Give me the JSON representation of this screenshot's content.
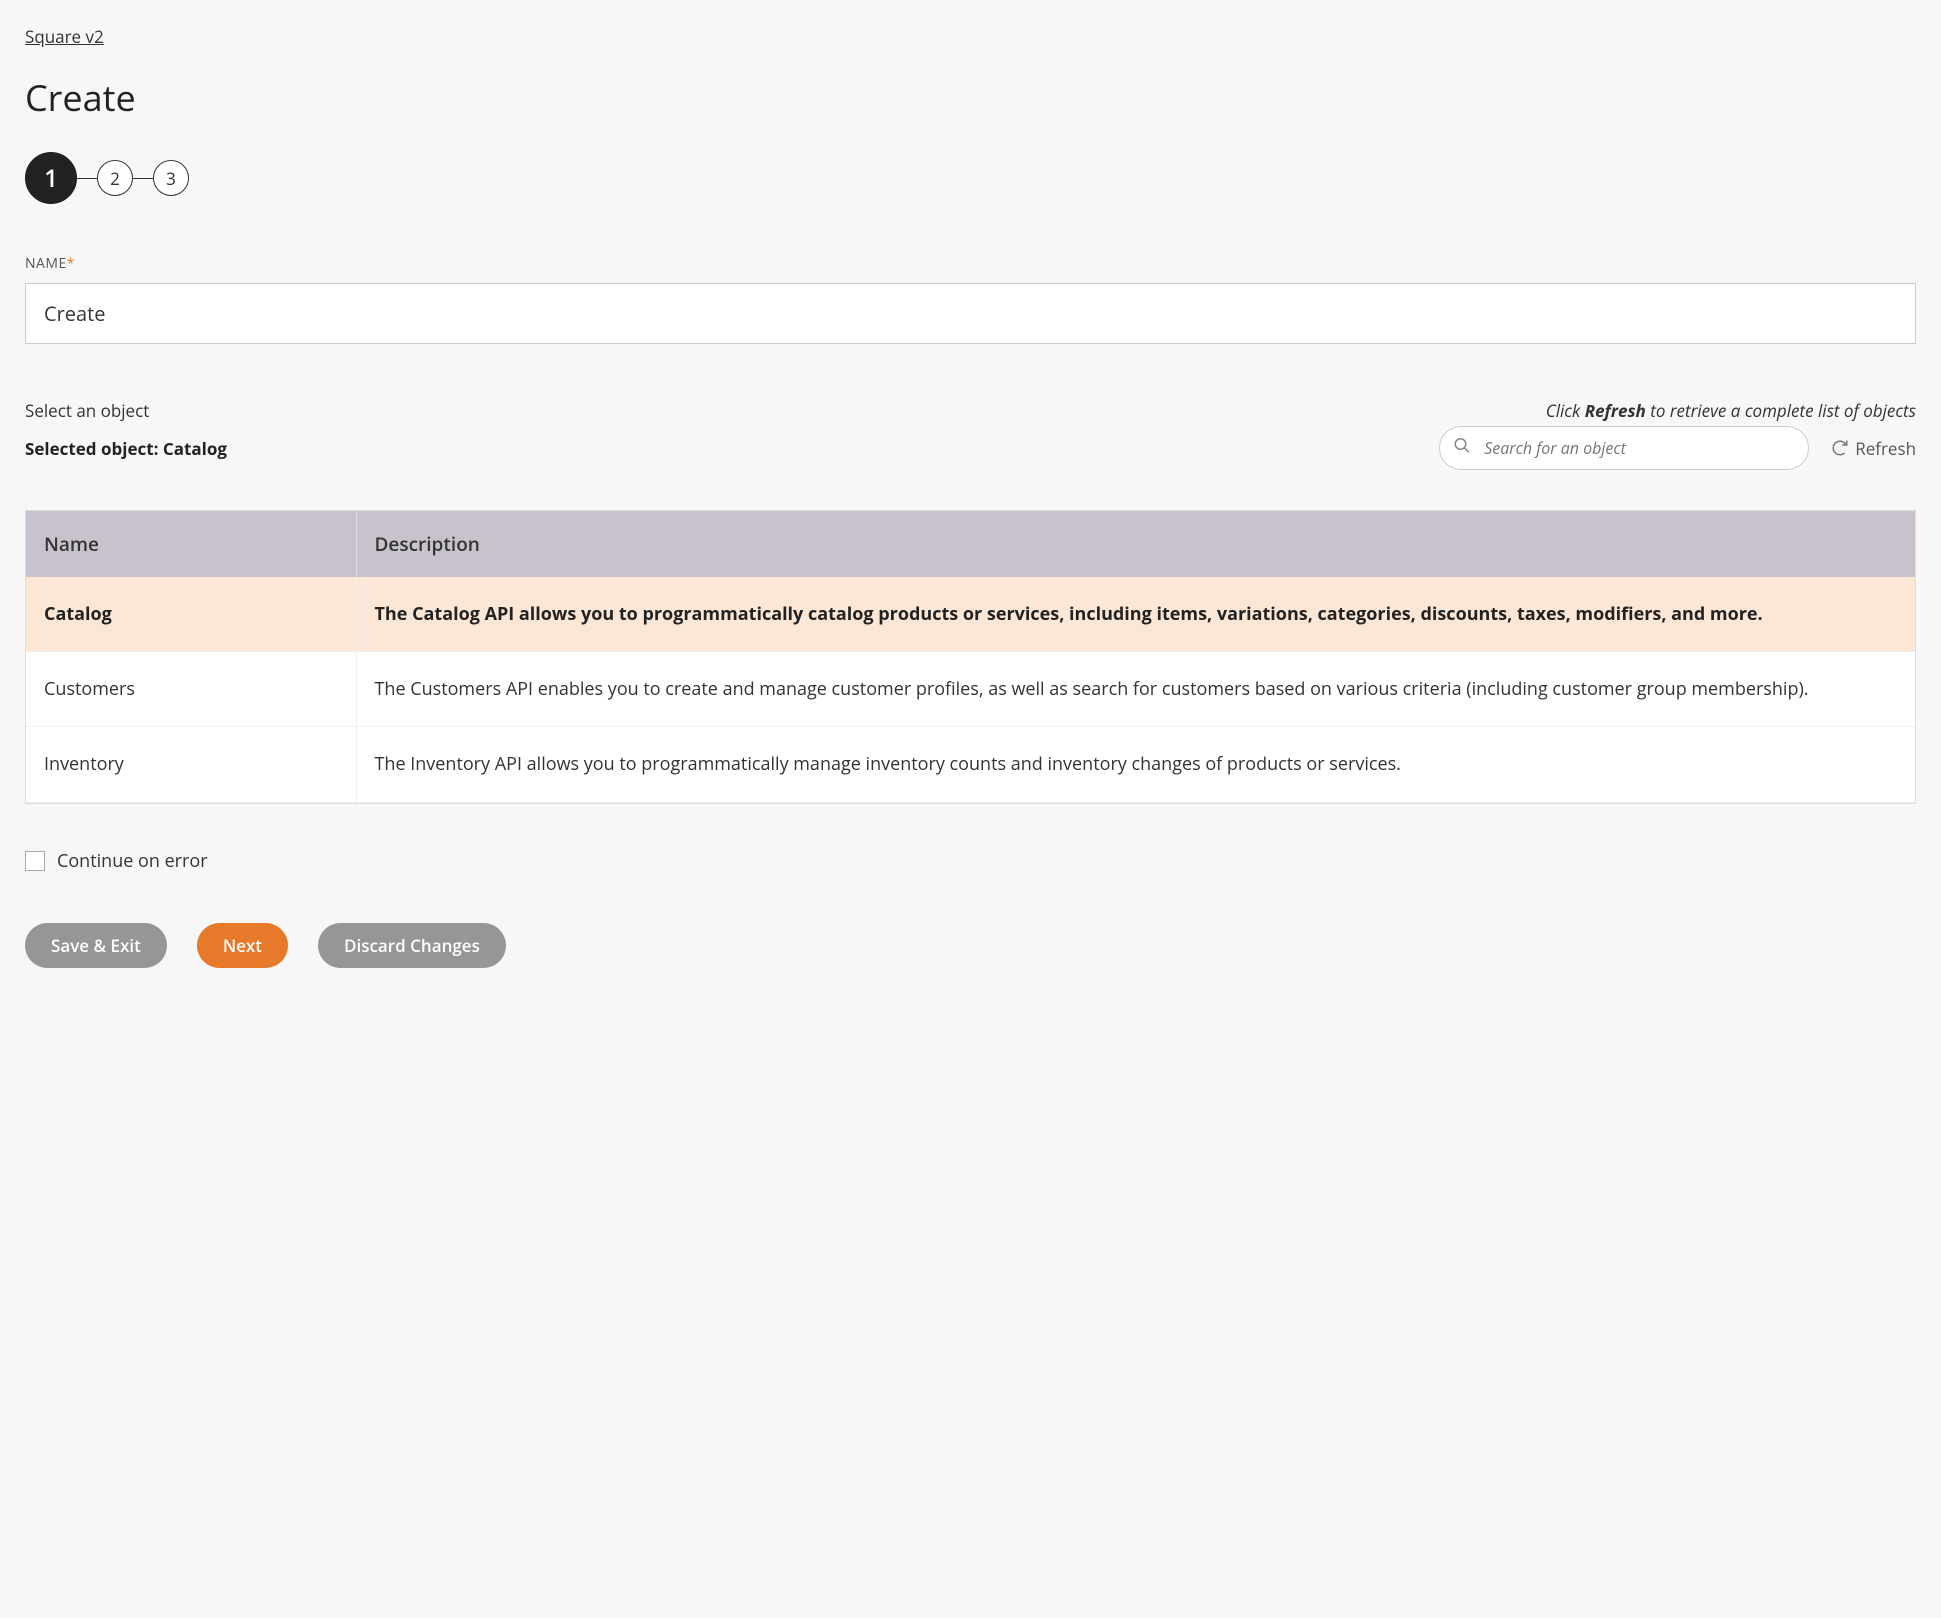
{
  "breadcrumb": "Square v2",
  "title": "Create",
  "steps": [
    "1",
    "2",
    "3"
  ],
  "activeStep": 0,
  "nameField": {
    "label": "NAME",
    "required": "*",
    "value": "Create"
  },
  "objectSection": {
    "prompt": "Select an object",
    "hintPrefix": "Click ",
    "hintBold": "Refresh",
    "hintSuffix": " to retrieve a complete list of objects",
    "selectedPrefix": "Selected object: ",
    "selectedValue": "Catalog",
    "searchPlaceholder": "Search for an object",
    "refreshLabel": "Refresh"
  },
  "table": {
    "columns": [
      "Name",
      "Description"
    ],
    "rows": [
      {
        "name": "Catalog",
        "desc": "The Catalog API allows you to programmatically catalog products or services, including items, variations, categories, discounts, taxes, modifiers, and more.",
        "selected": true
      },
      {
        "name": "Customers",
        "desc": "The Customers API enables you to create and manage customer profiles, as well as search for customers based on various criteria (including customer group membership).",
        "selected": false
      },
      {
        "name": "Inventory",
        "desc": "The Inventory API allows you to programmatically manage inventory counts and inventory changes of products or services.",
        "selected": false
      }
    ]
  },
  "continueOnError": "Continue on error",
  "buttons": {
    "save": "Save & Exit",
    "next": "Next",
    "discard": "Discard Changes"
  }
}
